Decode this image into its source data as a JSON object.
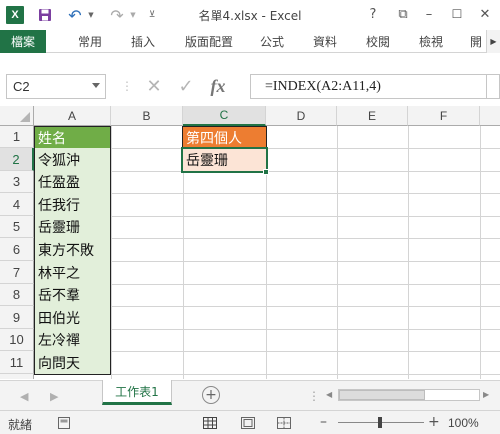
{
  "window": {
    "title": "名單4.xlsx - Excel",
    "help": "?",
    "restore": "⧉",
    "minimize": "–",
    "maximize": "☐",
    "close": "✕"
  },
  "qat": {
    "undo": "↶",
    "redo": "↷"
  },
  "ribbon": {
    "tabs": [
      "檔案",
      "常用",
      "插入",
      "版面配置",
      "公式",
      "資料",
      "校閱",
      "檢視",
      "開"
    ]
  },
  "formula_bar": {
    "name_box": "C2",
    "cancel": "✕",
    "enter": "✓",
    "fx": "fx",
    "formula": "=INDEX(A2:A11,4)"
  },
  "grid": {
    "columns": [
      "A",
      "B",
      "C",
      "D",
      "E",
      "F"
    ],
    "rows": [
      "1",
      "2",
      "3",
      "4",
      "5",
      "6",
      "7",
      "8",
      "9",
      "10",
      "11",
      "12"
    ],
    "selected_cell": "C2",
    "column_a": [
      "姓名",
      "令狐沖",
      "任盈盈",
      "任我行",
      "岳靈珊",
      "東方不敗",
      "林平之",
      "岳不羣",
      "田伯光",
      "左冷禪",
      "向問天"
    ],
    "c1": "第四個人",
    "c2": "岳靈珊"
  },
  "sheets": {
    "active": "工作表1",
    "add": "+"
  },
  "status": {
    "ready": "就緒",
    "zoom": "100%",
    "zoom_minus": "–",
    "zoom_plus": "+"
  },
  "colors": {
    "accent": "#217346",
    "header_green": "#70ad47",
    "light_green": "#e2efda",
    "orange": "#ed7d31",
    "light_orange": "#fce4d6"
  }
}
